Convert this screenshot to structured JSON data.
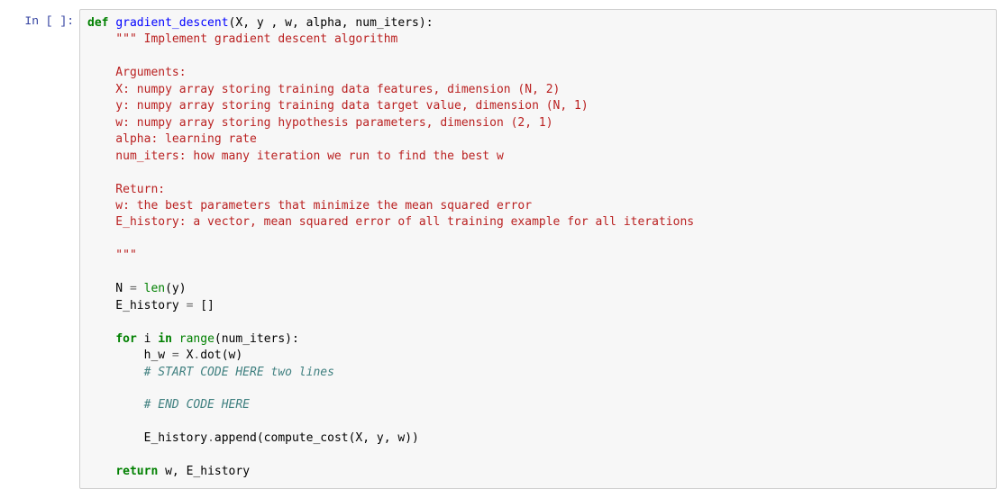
{
  "prompt": "In [ ]:",
  "code": {
    "l1_kw": "def",
    "l1_fn": "gradient_descent",
    "l1_rest": "(X, y , w, alpha, num_iters):",
    "doc_open": "\"\"\"",
    "doc_l1": " Implement gradient descent algorithm",
    "doc_blank1": "",
    "doc_l2": "    Arguments:",
    "doc_l3": "    X: numpy array storing training data features, dimension (N, 2)",
    "doc_l4": "    y: numpy array storing training data target value, dimension (N, 1)",
    "doc_l5": "    w: numpy array storing hypothesis parameters, dimension (2, 1)",
    "doc_l6": "    alpha: learning rate",
    "doc_l7": "    num_iters: how many iteration we run to find the best w",
    "doc_blank2": "",
    "doc_l8": "    Return:",
    "doc_l9": "    w: the best parameters that minimize the mean squared error",
    "doc_l10": "    E_history: a vector, mean squared error of all training example for all iterations",
    "doc_blank3": "",
    "doc_close": "    \"\"\"",
    "l_N_a": "    N ",
    "l_N_op": "=",
    "l_N_b": " ",
    "l_N_fn": "len",
    "l_N_c": "(y)",
    "l_E_a": "    E_history ",
    "l_E_op": "=",
    "l_E_b": " []",
    "for_kw1": "for",
    "for_mid": " i ",
    "for_kw2": "in",
    "for_sp": " ",
    "for_fn": "range",
    "for_rest": "(num_iters):",
    "hw_a": "        h_w ",
    "hw_op": "=",
    "hw_b": " X",
    "hw_op2": ".",
    "hw_c": "dot(w)",
    "cmt1": "        # START CODE HERE two lines",
    "cmt2": "        # END CODE HERE",
    "app_a": "        E_history",
    "app_op": ".",
    "app_b": "append(compute_cost(X, y, w))",
    "ret_kw": "return",
    "ret_rest": " w, E_history"
  }
}
